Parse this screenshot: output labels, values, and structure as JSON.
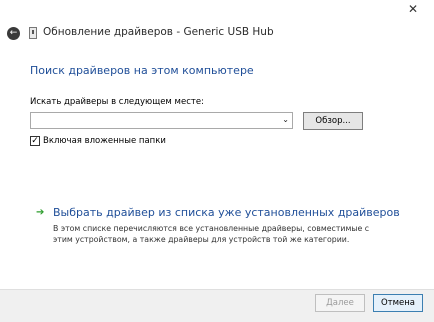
{
  "window": {
    "title": "Обновление драйверов - Generic USB Hub",
    "close_glyph": "✕",
    "back_glyph": "←"
  },
  "content": {
    "heading": "Поиск драйверов на этом компьютере",
    "search_label": "Искать драйверы в следующем месте:",
    "path_value": "",
    "browse_label": "Обзор...",
    "include_subfolders": {
      "checked": true,
      "label": "Включая вложенные папки"
    }
  },
  "pick_option": {
    "title": "Выбрать драйвер из списка уже установленных драйверов",
    "description": "В этом списке перечисляются все установленные драйверы, совместимые с этим устройством, а также драйверы для устройств той же категории."
  },
  "footer": {
    "next_label": "Далее",
    "cancel_label": "Отмена"
  },
  "icons": {
    "back": "back-arrow-icon",
    "device": "usb-device-icon",
    "close": "close-icon",
    "combo": "chevron-down-icon",
    "pick": "green-arrow-icon"
  },
  "colors": {
    "heading_blue": "#1f4e98",
    "arrow_green": "#2f9e2f",
    "default_button_border": "#3c7fb1"
  }
}
